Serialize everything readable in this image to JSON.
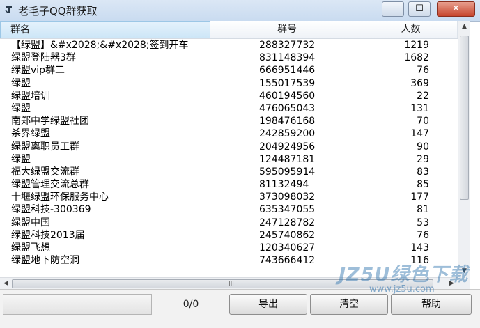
{
  "window": {
    "title": "老毛子QQ群获取",
    "min_glyph": "—",
    "max_glyph": "☐",
    "close_glyph": "✕"
  },
  "list": {
    "headers": {
      "name": "群名",
      "number": "群号",
      "count": "人数"
    },
    "rows": [
      {
        "name": "【绿盟】&#x2028;&#x2028;签到开车",
        "number": "288327732",
        "count": "1219"
      },
      {
        "name": "绿盟登陆器3群",
        "number": "831148394",
        "count": "1682"
      },
      {
        "name": "绿盟vip群二",
        "number": "666951446",
        "count": "76"
      },
      {
        "name": "绿盟",
        "number": "155017539",
        "count": "369"
      },
      {
        "name": "绿盟培训",
        "number": "460194560",
        "count": "22"
      },
      {
        "name": "绿盟",
        "number": "476065043",
        "count": "131"
      },
      {
        "name": "南郑中学绿盟社团",
        "number": "198476168",
        "count": "70"
      },
      {
        "name": "杀界绿盟",
        "number": "242859200",
        "count": "147"
      },
      {
        "name": "绿盟离职员工群",
        "number": "204924956",
        "count": "90"
      },
      {
        "name": "绿盟",
        "number": "124487181",
        "count": "29"
      },
      {
        "name": "福大绿盟交流群",
        "number": "595095914",
        "count": "83"
      },
      {
        "name": "绿盟管理交流总群",
        "number": "81132494",
        "count": "85"
      },
      {
        "name": "十堰绿盟环保服务中心",
        "number": "373098032",
        "count": "177"
      },
      {
        "name": "绿盟科技-300369",
        "number": "635347055",
        "count": "81"
      },
      {
        "name": "绿盟中国",
        "number": "247128782",
        "count": "53"
      },
      {
        "name": "绿盟科技2013届",
        "number": "245740862",
        "count": "76"
      },
      {
        "name": "绿盟飞想",
        "number": "120340627",
        "count": "143"
      },
      {
        "name": "绿盟地下防空洞",
        "number": "743666412",
        "count": "116"
      }
    ]
  },
  "scrollbars": {
    "up_arrow": "▲",
    "down_arrow": "▼",
    "left_arrow": "◀",
    "right_arrow": "▶",
    "grip": "III"
  },
  "bottom": {
    "counter": "0/0",
    "export_label": "导出",
    "clear_label": "清空",
    "help_label": "帮助"
  },
  "watermark": {
    "brand": "JZ5U绿色下载",
    "url": "www.jz5u.com"
  },
  "colors": {
    "titlebar": "#c9dbf0",
    "close_button": "#c6452d",
    "header_selected": "#cde6f7"
  }
}
